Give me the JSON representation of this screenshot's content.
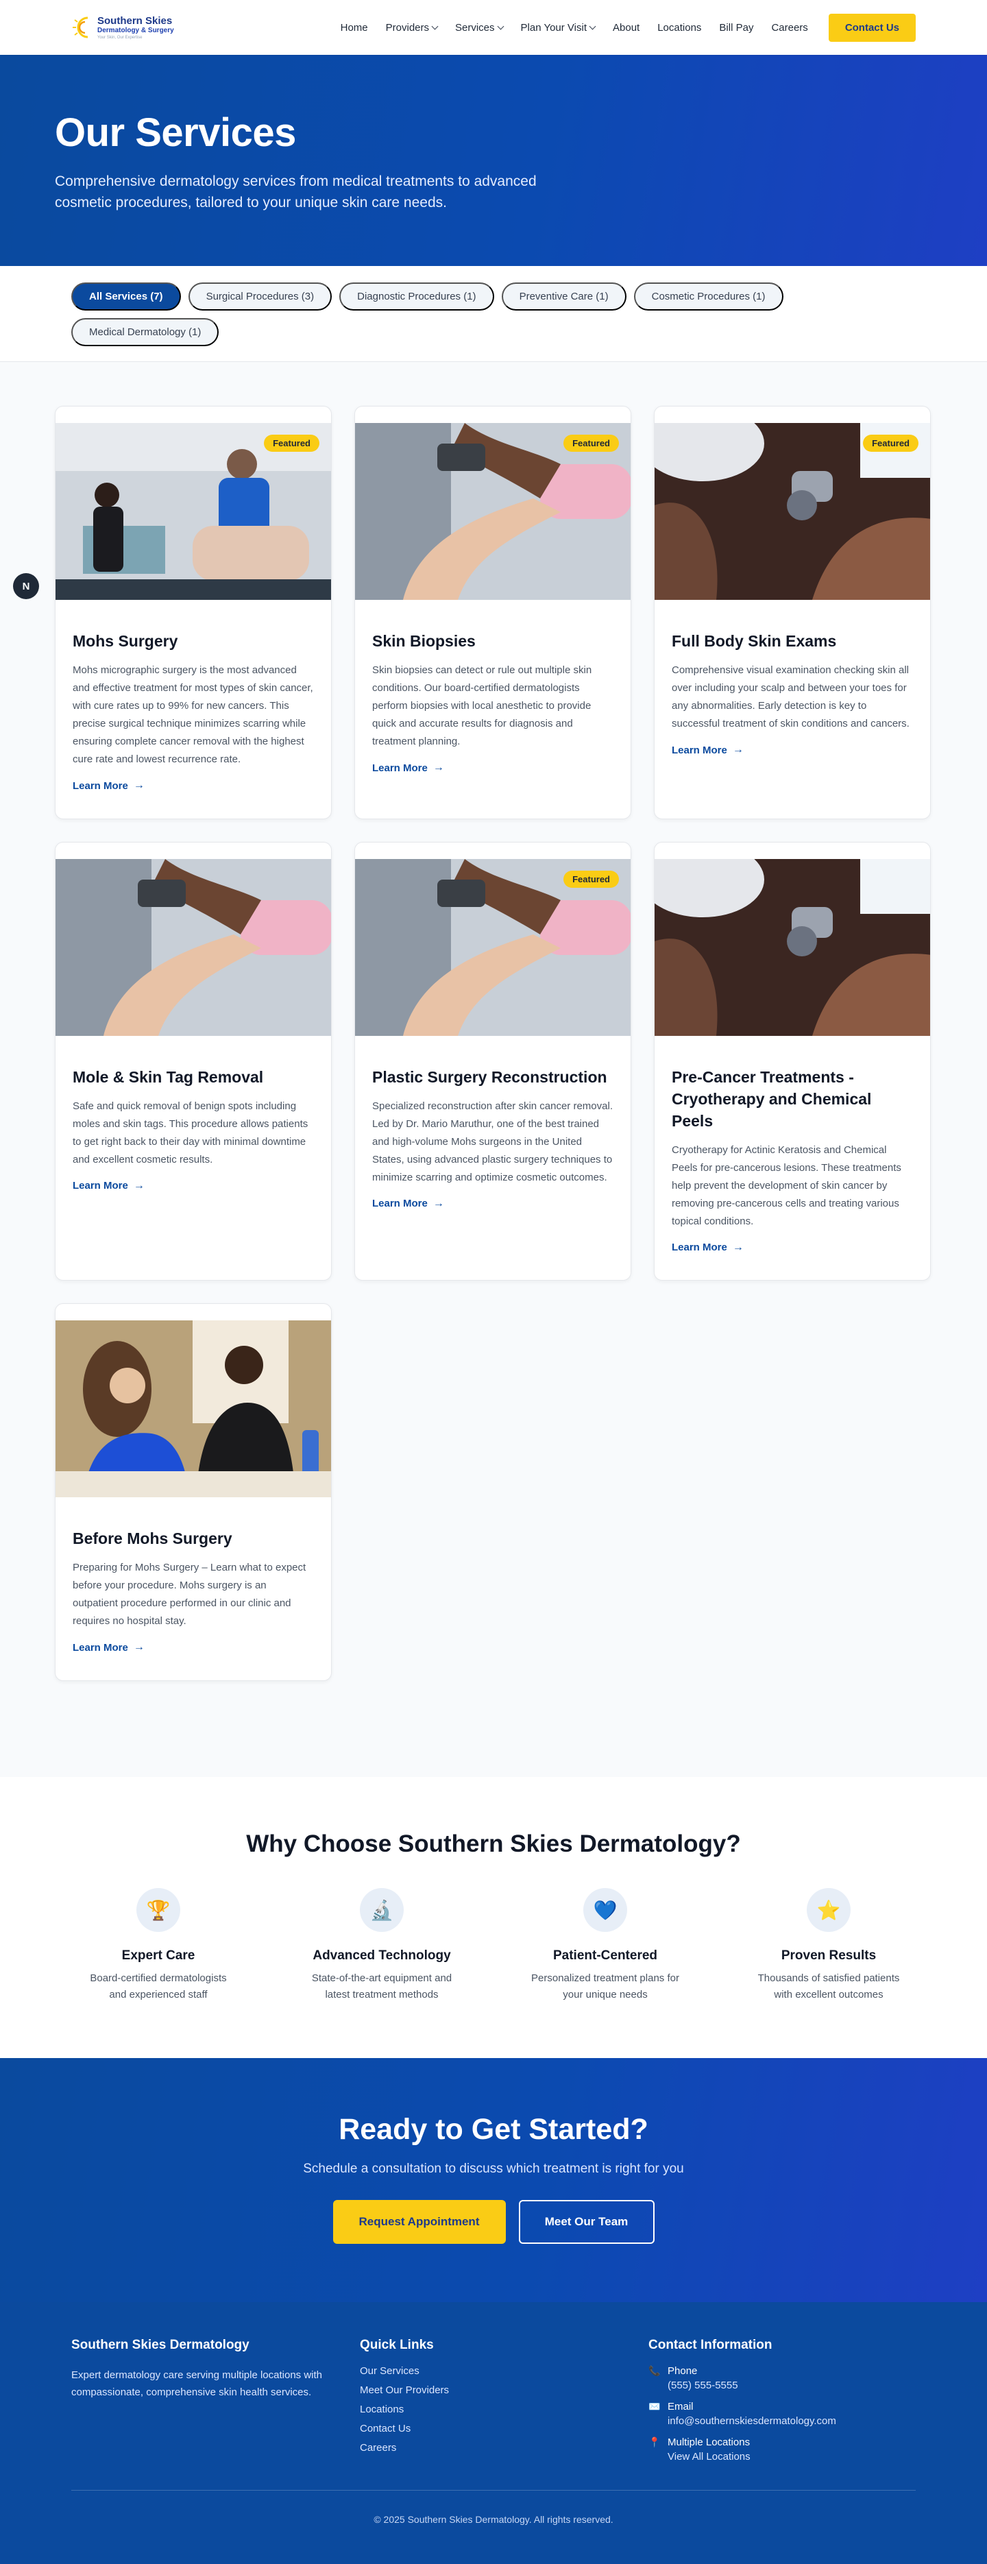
{
  "header": {
    "logo_name": "Southern Skies",
    "logo_sub": "Dermatology & Surgery",
    "logo_tag": "Your Skin, Our Expertise",
    "nav": [
      {
        "label": "Home",
        "dropdown": false
      },
      {
        "label": "Providers",
        "dropdown": true
      },
      {
        "label": "Services",
        "dropdown": true
      },
      {
        "label": "Plan Your Visit",
        "dropdown": true
      },
      {
        "label": "About",
        "dropdown": false
      },
      {
        "label": "Locations",
        "dropdown": false
      },
      {
        "label": "Bill Pay",
        "dropdown": false
      },
      {
        "label": "Careers",
        "dropdown": false
      }
    ],
    "contact_label": "Contact Us"
  },
  "hero": {
    "title": "Our Services",
    "subtitle": "Comprehensive dermatology services from medical treatments to advanced cosmetic procedures, tailored to your unique skin care needs."
  },
  "filters": [
    {
      "label": "All Services (7)",
      "active": true
    },
    {
      "label": "Surgical Procedures (3)",
      "active": false
    },
    {
      "label": "Diagnostic Procedures (1)",
      "active": false
    },
    {
      "label": "Preventive Care (1)",
      "active": false
    },
    {
      "label": "Cosmetic Procedures (1)",
      "active": false
    },
    {
      "label": "Medical Dermatology (1)",
      "active": false
    }
  ],
  "side_button_label": "N",
  "services": [
    {
      "title": "Mohs Surgery",
      "featured": true,
      "image": "mohs",
      "description": "Mohs micrographic surgery is the most advanced and effective treatment for most types of skin cancer, with cure rates up to 99% for new cancers. This precise surgical technique minimizes scarring while ensuring complete cancer removal with the highest cure rate and lowest recurrence rate.",
      "link": "Learn More"
    },
    {
      "title": "Skin Biopsies",
      "featured": true,
      "image": "biopsy",
      "description": "Skin biopsies can detect or rule out multiple skin conditions. Our board-certified dermatologists perform biopsies with local anesthetic to provide quick and accurate results for diagnosis and treatment planning.",
      "link": "Learn More"
    },
    {
      "title": "Full Body Skin Exams",
      "featured": true,
      "image": "exam",
      "description": "Comprehensive visual examination checking skin all over including your scalp and between your toes for any abnormalities. Early detection is key to successful treatment of skin conditions and cancers.",
      "link": "Learn More"
    },
    {
      "title": "Mole & Skin Tag Removal",
      "featured": false,
      "image": "biopsy",
      "description": "Safe and quick removal of benign spots including moles and skin tags. This procedure allows patients to get right back to their day with minimal downtime and excellent cosmetic results.",
      "link": "Learn More"
    },
    {
      "title": "Plastic Surgery Reconstruction",
      "featured": true,
      "image": "biopsy",
      "description": "Specialized reconstruction after skin cancer removal. Led by Dr. Mario Maruthur, one of the best trained and high-volume Mohs surgeons in the United States, using advanced plastic surgery techniques to minimize scarring and optimize cosmetic outcomes.",
      "link": "Learn More"
    },
    {
      "title": "Pre-Cancer Treatments - Cryotherapy and Chemical Peels",
      "featured": false,
      "image": "exam",
      "description": "Cryotherapy for Actinic Keratosis and Chemical Peels for pre-cancerous lesions. These treatments help prevent the development of skin cancer by removing pre-cancerous cells and treating various topical conditions.",
      "link": "Learn More"
    },
    {
      "title": "Before Mohs Surgery",
      "featured": false,
      "image": "team",
      "description": "Preparing for Mohs Surgery – Learn what to expect before your procedure. Mohs surgery is an outpatient procedure performed in our clinic and requires no hospital stay.",
      "link": "Learn More"
    }
  ],
  "featured_label": "Featured",
  "why": {
    "title": "Why Choose Southern Skies Dermatology?",
    "features": [
      {
        "icon": "trophy-icon",
        "glyph": "🏆",
        "title": "Expert Care",
        "desc": "Board-certified dermatologists and experienced staff"
      },
      {
        "icon": "microscope-icon",
        "glyph": "🔬",
        "title": "Advanced Technology",
        "desc": "State-of-the-art equipment and latest treatment methods"
      },
      {
        "icon": "heart-icon",
        "glyph": "💙",
        "title": "Patient-Centered",
        "desc": "Personalized treatment plans for your unique needs"
      },
      {
        "icon": "star-icon",
        "glyph": "⭐",
        "title": "Proven Results",
        "desc": "Thousands of satisfied patients with excellent outcomes"
      }
    ]
  },
  "cta": {
    "title": "Ready to Get Started?",
    "subtitle": "Schedule a consultation to discuss which treatment is right for you",
    "primary": "Request Appointment",
    "secondary": "Meet Our Team"
  },
  "footer": {
    "brand_title": "Southern Skies Dermatology",
    "brand_desc": "Expert dermatology care serving multiple locations with compassionate, comprehensive skin health services.",
    "links_title": "Quick Links",
    "links": [
      "Our Services",
      "Meet Our Providers",
      "Locations",
      "Contact Us",
      "Careers"
    ],
    "contact_title": "Contact Information",
    "contact": [
      {
        "icon": "phone-icon",
        "glyph": "📞",
        "label": "Phone",
        "value": "(555) 555-5555"
      },
      {
        "icon": "email-icon",
        "glyph": "✉️",
        "label": "Email",
        "value": "info@southernskiesdermatology.com"
      },
      {
        "icon": "location-pin-icon",
        "glyph": "📍",
        "label": "Multiple Locations",
        "value": "View All Locations"
      }
    ],
    "copyright": "© 2025 Southern Skies Dermatology. All rights reserved."
  },
  "colors": {
    "primary": "#0b4a9e",
    "accent": "#facc15",
    "hero_gradient_end": "#1e3fc4"
  }
}
